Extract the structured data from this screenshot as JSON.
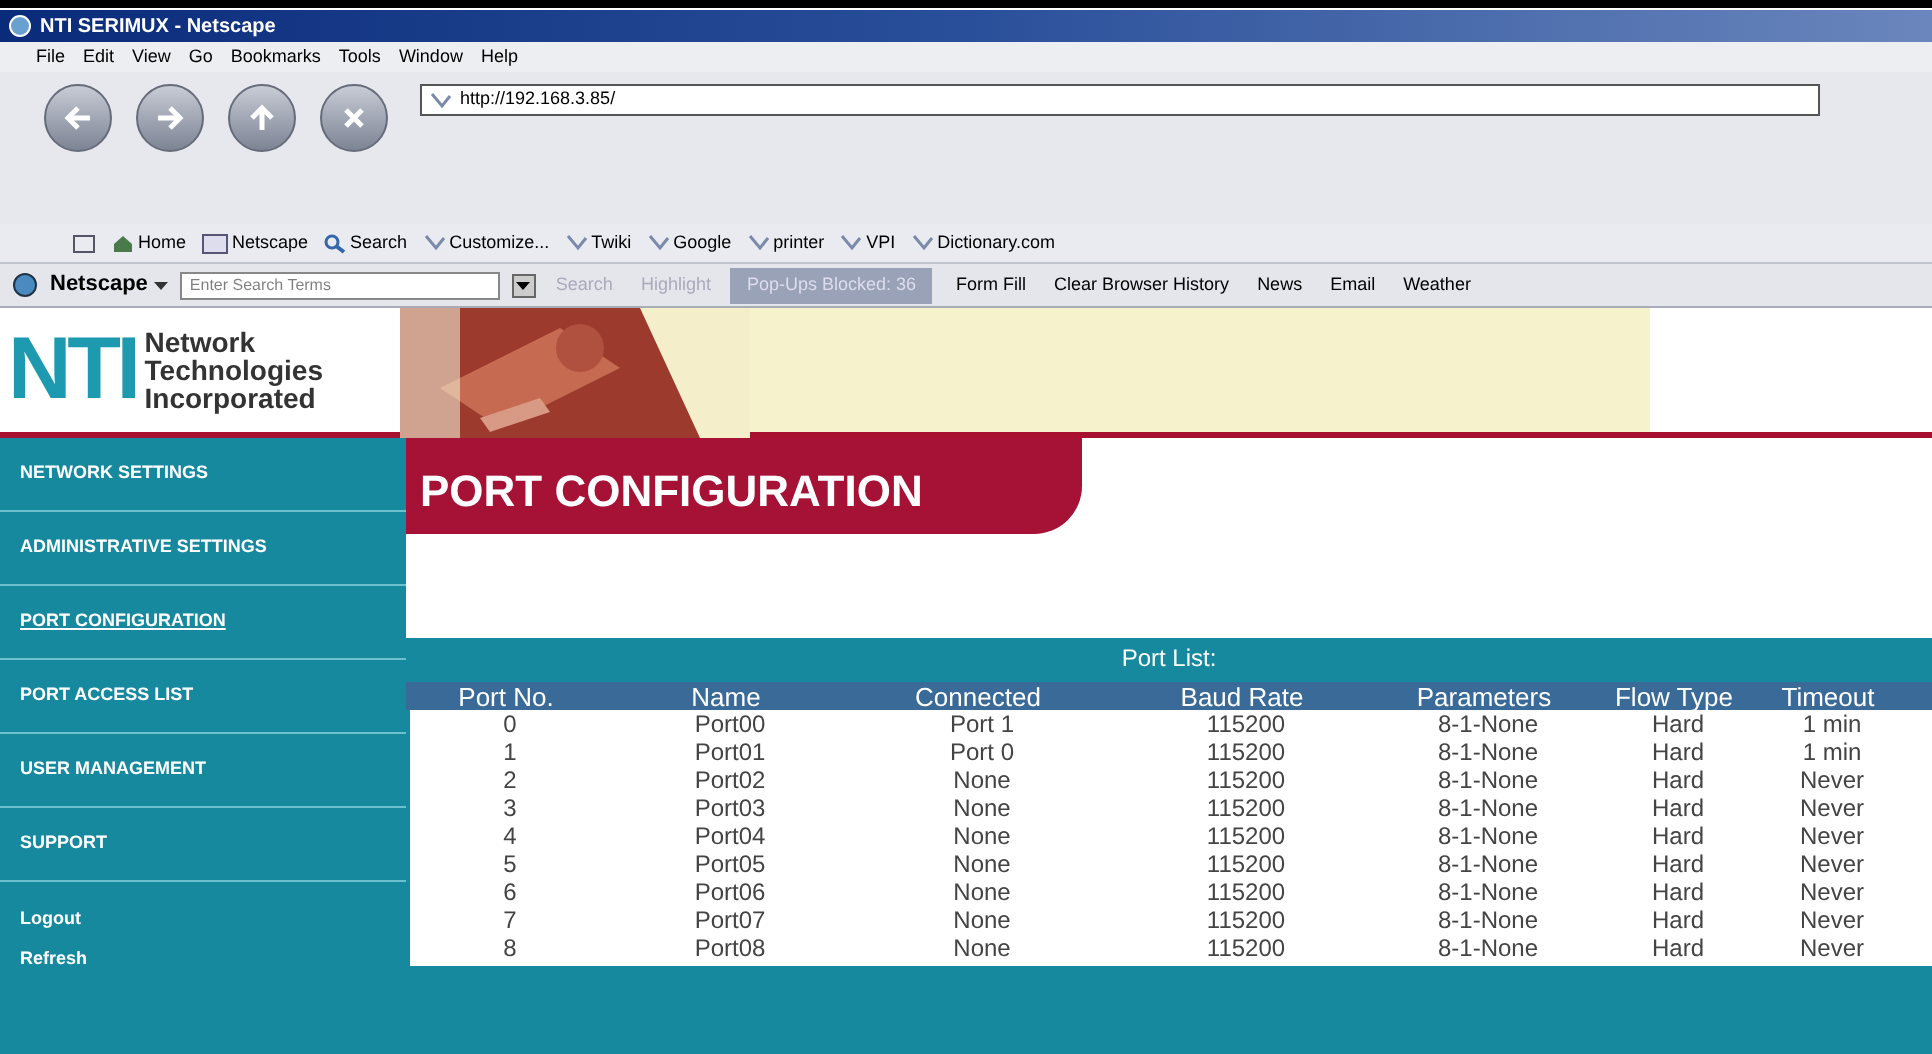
{
  "window": {
    "title": "NTI SERIMUX - Netscape"
  },
  "menu": [
    "File",
    "Edit",
    "View",
    "Go",
    "Bookmarks",
    "Tools",
    "Window",
    "Help"
  ],
  "address": {
    "value": "http://192.168.3.85/"
  },
  "bookmarks": [
    "Home",
    "Netscape",
    "Search",
    "Customize...",
    "Twiki",
    "Google",
    "printer",
    "VPI",
    "Dictionary.com"
  ],
  "netscape_toolbar": {
    "brand": "Netscape",
    "search_placeholder": "Enter Search Terms",
    "search_button": "Search",
    "highlight_button": "Highlight",
    "popups": "Pop-Ups Blocked: 36",
    "items": [
      "Form Fill",
      "Clear Browser History",
      "News",
      "Email",
      "Weather"
    ]
  },
  "banner": {
    "logo": "NTI",
    "company": [
      "Network",
      "Technologies",
      "Incorporated"
    ]
  },
  "sidebar": {
    "items": [
      {
        "label": "NETWORK SETTINGS",
        "selected": false
      },
      {
        "label": "ADMINISTRATIVE SETTINGS",
        "selected": false
      },
      {
        "label": "PORT CONFIGURATION",
        "selected": true
      },
      {
        "label": "PORT ACCESS LIST",
        "selected": false
      },
      {
        "label": "USER MANAGEMENT",
        "selected": false
      },
      {
        "label": "SUPPORT",
        "selected": false
      }
    ],
    "links": [
      "Logout",
      "Refresh"
    ]
  },
  "page_title": "PORT CONFIGURATION",
  "table": {
    "caption": "Port List:",
    "columns": [
      "Port No.",
      "Name",
      "Connected",
      "Baud Rate",
      "Parameters",
      "Flow Type",
      "Timeout"
    ],
    "rows": [
      [
        "0",
        "Port00",
        "Port 1",
        "115200",
        "8-1-None",
        "Hard",
        "1 min"
      ],
      [
        "1",
        "Port01",
        "Port 0",
        "115200",
        "8-1-None",
        "Hard",
        "1 min"
      ],
      [
        "2",
        "Port02",
        "None",
        "115200",
        "8-1-None",
        "Hard",
        "Never"
      ],
      [
        "3",
        "Port03",
        "None",
        "115200",
        "8-1-None",
        "Hard",
        "Never"
      ],
      [
        "4",
        "Port04",
        "None",
        "115200",
        "8-1-None",
        "Hard",
        "Never"
      ],
      [
        "5",
        "Port05",
        "None",
        "115200",
        "8-1-None",
        "Hard",
        "Never"
      ],
      [
        "6",
        "Port06",
        "None",
        "115200",
        "8-1-None",
        "Hard",
        "Never"
      ],
      [
        "7",
        "Port07",
        "None",
        "115200",
        "8-1-None",
        "Hard",
        "Never"
      ],
      [
        "8",
        "Port08",
        "None",
        "115200",
        "8-1-None",
        "Hard",
        "Never"
      ]
    ]
  }
}
